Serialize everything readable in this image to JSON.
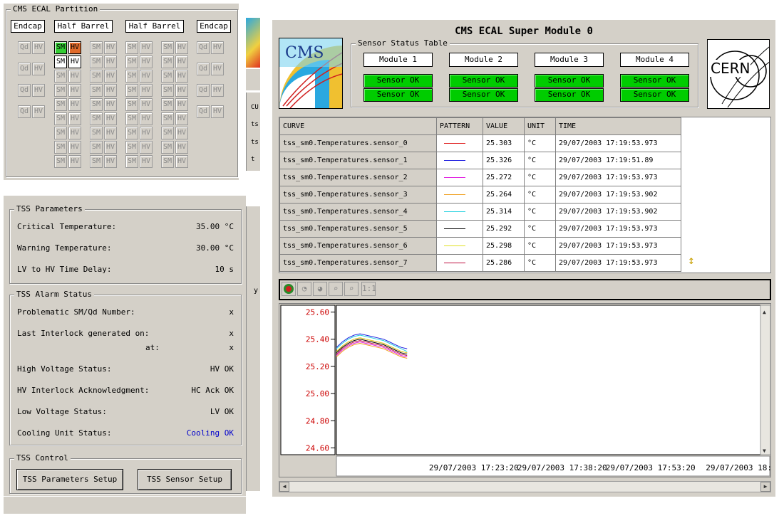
{
  "partition": {
    "title": "CMS ECAL Partition",
    "headers": [
      "Endcap",
      "Half Barrel",
      "Half Barrel",
      "Endcap"
    ],
    "qd": "Qd",
    "hv": "HV",
    "sm": "SM"
  },
  "tss_params": {
    "title": "TSS Parameters",
    "rows": [
      {
        "label": "Critical Temperature:",
        "value": "35.00 °C"
      },
      {
        "label": "Warning Temperature:",
        "value": "30.00 °C"
      },
      {
        "label": "LV to HV Time Delay:",
        "value": "10 s"
      }
    ]
  },
  "tss_alarm": {
    "title": "TSS Alarm Status",
    "rows": [
      {
        "label": "Problematic SM/Qd Number:",
        "value": "x"
      },
      {
        "label": "Last Interlock generated on:",
        "value": "x"
      },
      {
        "label": "at:",
        "value": "x"
      },
      {
        "label": "High Voltage Status:",
        "value": "HV OK"
      },
      {
        "label": "HV Interlock Acknowledgment:",
        "value": "HC Ack OK"
      },
      {
        "label": "Low Voltage Status:",
        "value": "LV OK"
      },
      {
        "label": "Cooling Unit Status:",
        "value": "Cooling OK"
      }
    ],
    "cooling_color": "#0000cc"
  },
  "tss_control": {
    "title": "TSS Control",
    "params_btn": "TSS Parameters Setup",
    "sensor_btn": "TSS Sensor Setup"
  },
  "bg_fragments": {
    "cu": "CU",
    "ts1": "ts",
    "ts2": "ts",
    "t": "t",
    "y": "y"
  },
  "super_module": {
    "title": "CMS ECAL Super Module 0",
    "cms_logo": "CMS",
    "cern_logo": "CERN",
    "sensor_table_title": "Sensor Status Table",
    "modules": [
      {
        "name": "Module 1",
        "s1": "Sensor OK",
        "s2": "Sensor OK"
      },
      {
        "name": "Module 2",
        "s1": "Sensor OK",
        "s2": "Sensor OK"
      },
      {
        "name": "Module 3",
        "s1": "Sensor OK",
        "s2": "Sensor OK"
      },
      {
        "name": "Module 4",
        "s1": "Sensor OK",
        "s2": "Sensor OK"
      }
    ],
    "ok_color": "#00cc00"
  },
  "curves": {
    "headers": [
      "CURVE",
      "PATTERN",
      "VALUE",
      "UNIT",
      "TIME"
    ],
    "rows": [
      {
        "curve": "tss_sm0.Temperatures.sensor_0",
        "color": "#e02020",
        "value": "25.303",
        "unit": "°C",
        "time": "29/07/2003 17:19:53.973"
      },
      {
        "curve": "tss_sm0.Temperatures.sensor_1",
        "color": "#2020e0",
        "value": "25.326",
        "unit": "°C",
        "time": "29/07/2003 17:19:51.89"
      },
      {
        "curve": "tss_sm0.Temperatures.sensor_2",
        "color": "#e020e0",
        "value": "25.272",
        "unit": "°C",
        "time": "29/07/2003 17:19:53.973"
      },
      {
        "curve": "tss_sm0.Temperatures.sensor_3",
        "color": "#f0a020",
        "value": "25.264",
        "unit": "°C",
        "time": "29/07/2003 17:19:53.902"
      },
      {
        "curve": "tss_sm0.Temperatures.sensor_4",
        "color": "#20d0e0",
        "value": "25.314",
        "unit": "°C",
        "time": "29/07/2003 17:19:53.902"
      },
      {
        "curve": "tss_sm0.Temperatures.sensor_5",
        "color": "#000000",
        "value": "25.292",
        "unit": "°C",
        "time": "29/07/2003 17:19:53.973"
      },
      {
        "curve": "tss_sm0.Temperatures.sensor_6",
        "color": "#e0e020",
        "value": "25.298",
        "unit": "°C",
        "time": "29/07/2003 17:19:53.973"
      },
      {
        "curve": "tss_sm0.Temperatures.sensor_7",
        "color": "#c01040",
        "value": "25.286",
        "unit": "°C",
        "time": "29/07/2003 17:19:53.973"
      }
    ]
  },
  "toolbar": {
    "zoom_reset": "1:1"
  },
  "chart_data": {
    "type": "line",
    "y_ticks": [
      "25.60",
      "25.40",
      "25.20",
      "25.00",
      "24.80",
      "24.60"
    ],
    "ylim": [
      24.55,
      25.65
    ],
    "x_ticks": [
      "29/07/2003 17:23:20",
      "29/07/2003 17:38:20",
      "29/07/2003 17:53:20",
      "29/07/2003 18:"
    ],
    "x_tick_minutes": [
      23.33,
      38.33,
      53.33,
      68.33
    ],
    "xlim_minutes": [
      0,
      72
    ],
    "tick_color": "#cc0000",
    "series": [
      {
        "color": "#e02020",
        "t": [
          0,
          1,
          2,
          3,
          4,
          5,
          6,
          7,
          8,
          9,
          10,
          11,
          12
        ],
        "v": [
          25.31,
          25.35,
          25.38,
          25.4,
          25.41,
          25.4,
          25.39,
          25.38,
          25.37,
          25.35,
          25.33,
          25.31,
          25.3
        ]
      },
      {
        "color": "#2020e0",
        "t": [
          0,
          1,
          2,
          3,
          4,
          5,
          6,
          7,
          8,
          9,
          10,
          11,
          12
        ],
        "v": [
          25.34,
          25.38,
          25.41,
          25.43,
          25.44,
          25.43,
          25.42,
          25.41,
          25.4,
          25.38,
          25.36,
          25.34,
          25.33
        ]
      },
      {
        "color": "#e020e0",
        "t": [
          0,
          1,
          2,
          3,
          4,
          5,
          6,
          7,
          8,
          9,
          10,
          11,
          12
        ],
        "v": [
          25.28,
          25.32,
          25.35,
          25.37,
          25.38,
          25.37,
          25.36,
          25.35,
          25.34,
          25.32,
          25.3,
          25.28,
          25.27
        ]
      },
      {
        "color": "#f0a020",
        "t": [
          0,
          1,
          2,
          3,
          4,
          5,
          6,
          7,
          8,
          9,
          10,
          11,
          12
        ],
        "v": [
          25.27,
          25.31,
          25.34,
          25.36,
          25.37,
          25.36,
          25.35,
          25.34,
          25.33,
          25.31,
          25.29,
          25.27,
          25.26
        ]
      },
      {
        "color": "#20d0e0",
        "t": [
          0,
          1,
          2,
          3,
          4,
          5,
          6,
          7,
          8,
          9,
          10,
          11,
          12
        ],
        "v": [
          25.33,
          25.37,
          25.4,
          25.42,
          25.43,
          25.42,
          25.41,
          25.4,
          25.39,
          25.37,
          25.35,
          25.33,
          25.31
        ]
      },
      {
        "color": "#000000",
        "t": [
          0,
          1,
          2,
          3,
          4,
          5,
          6,
          7,
          8,
          9,
          10,
          11,
          12
        ],
        "v": [
          25.3,
          25.34,
          25.37,
          25.39,
          25.4,
          25.39,
          25.38,
          25.37,
          25.36,
          25.34,
          25.32,
          25.3,
          25.29
        ]
      },
      {
        "color": "#e0e020",
        "t": [
          0,
          1,
          2,
          3,
          4,
          5,
          6,
          7,
          8,
          9,
          10,
          11,
          12
        ],
        "v": [
          25.31,
          25.35,
          25.38,
          25.4,
          25.41,
          25.4,
          25.39,
          25.38,
          25.37,
          25.35,
          25.33,
          25.31,
          25.3
        ]
      },
      {
        "color": "#c01040",
        "t": [
          0,
          1,
          2,
          3,
          4,
          5,
          6,
          7,
          8,
          9,
          10,
          11,
          12
        ],
        "v": [
          25.29,
          25.33,
          25.36,
          25.38,
          25.39,
          25.38,
          25.37,
          25.36,
          25.35,
          25.33,
          25.31,
          25.29,
          25.28
        ]
      }
    ]
  }
}
